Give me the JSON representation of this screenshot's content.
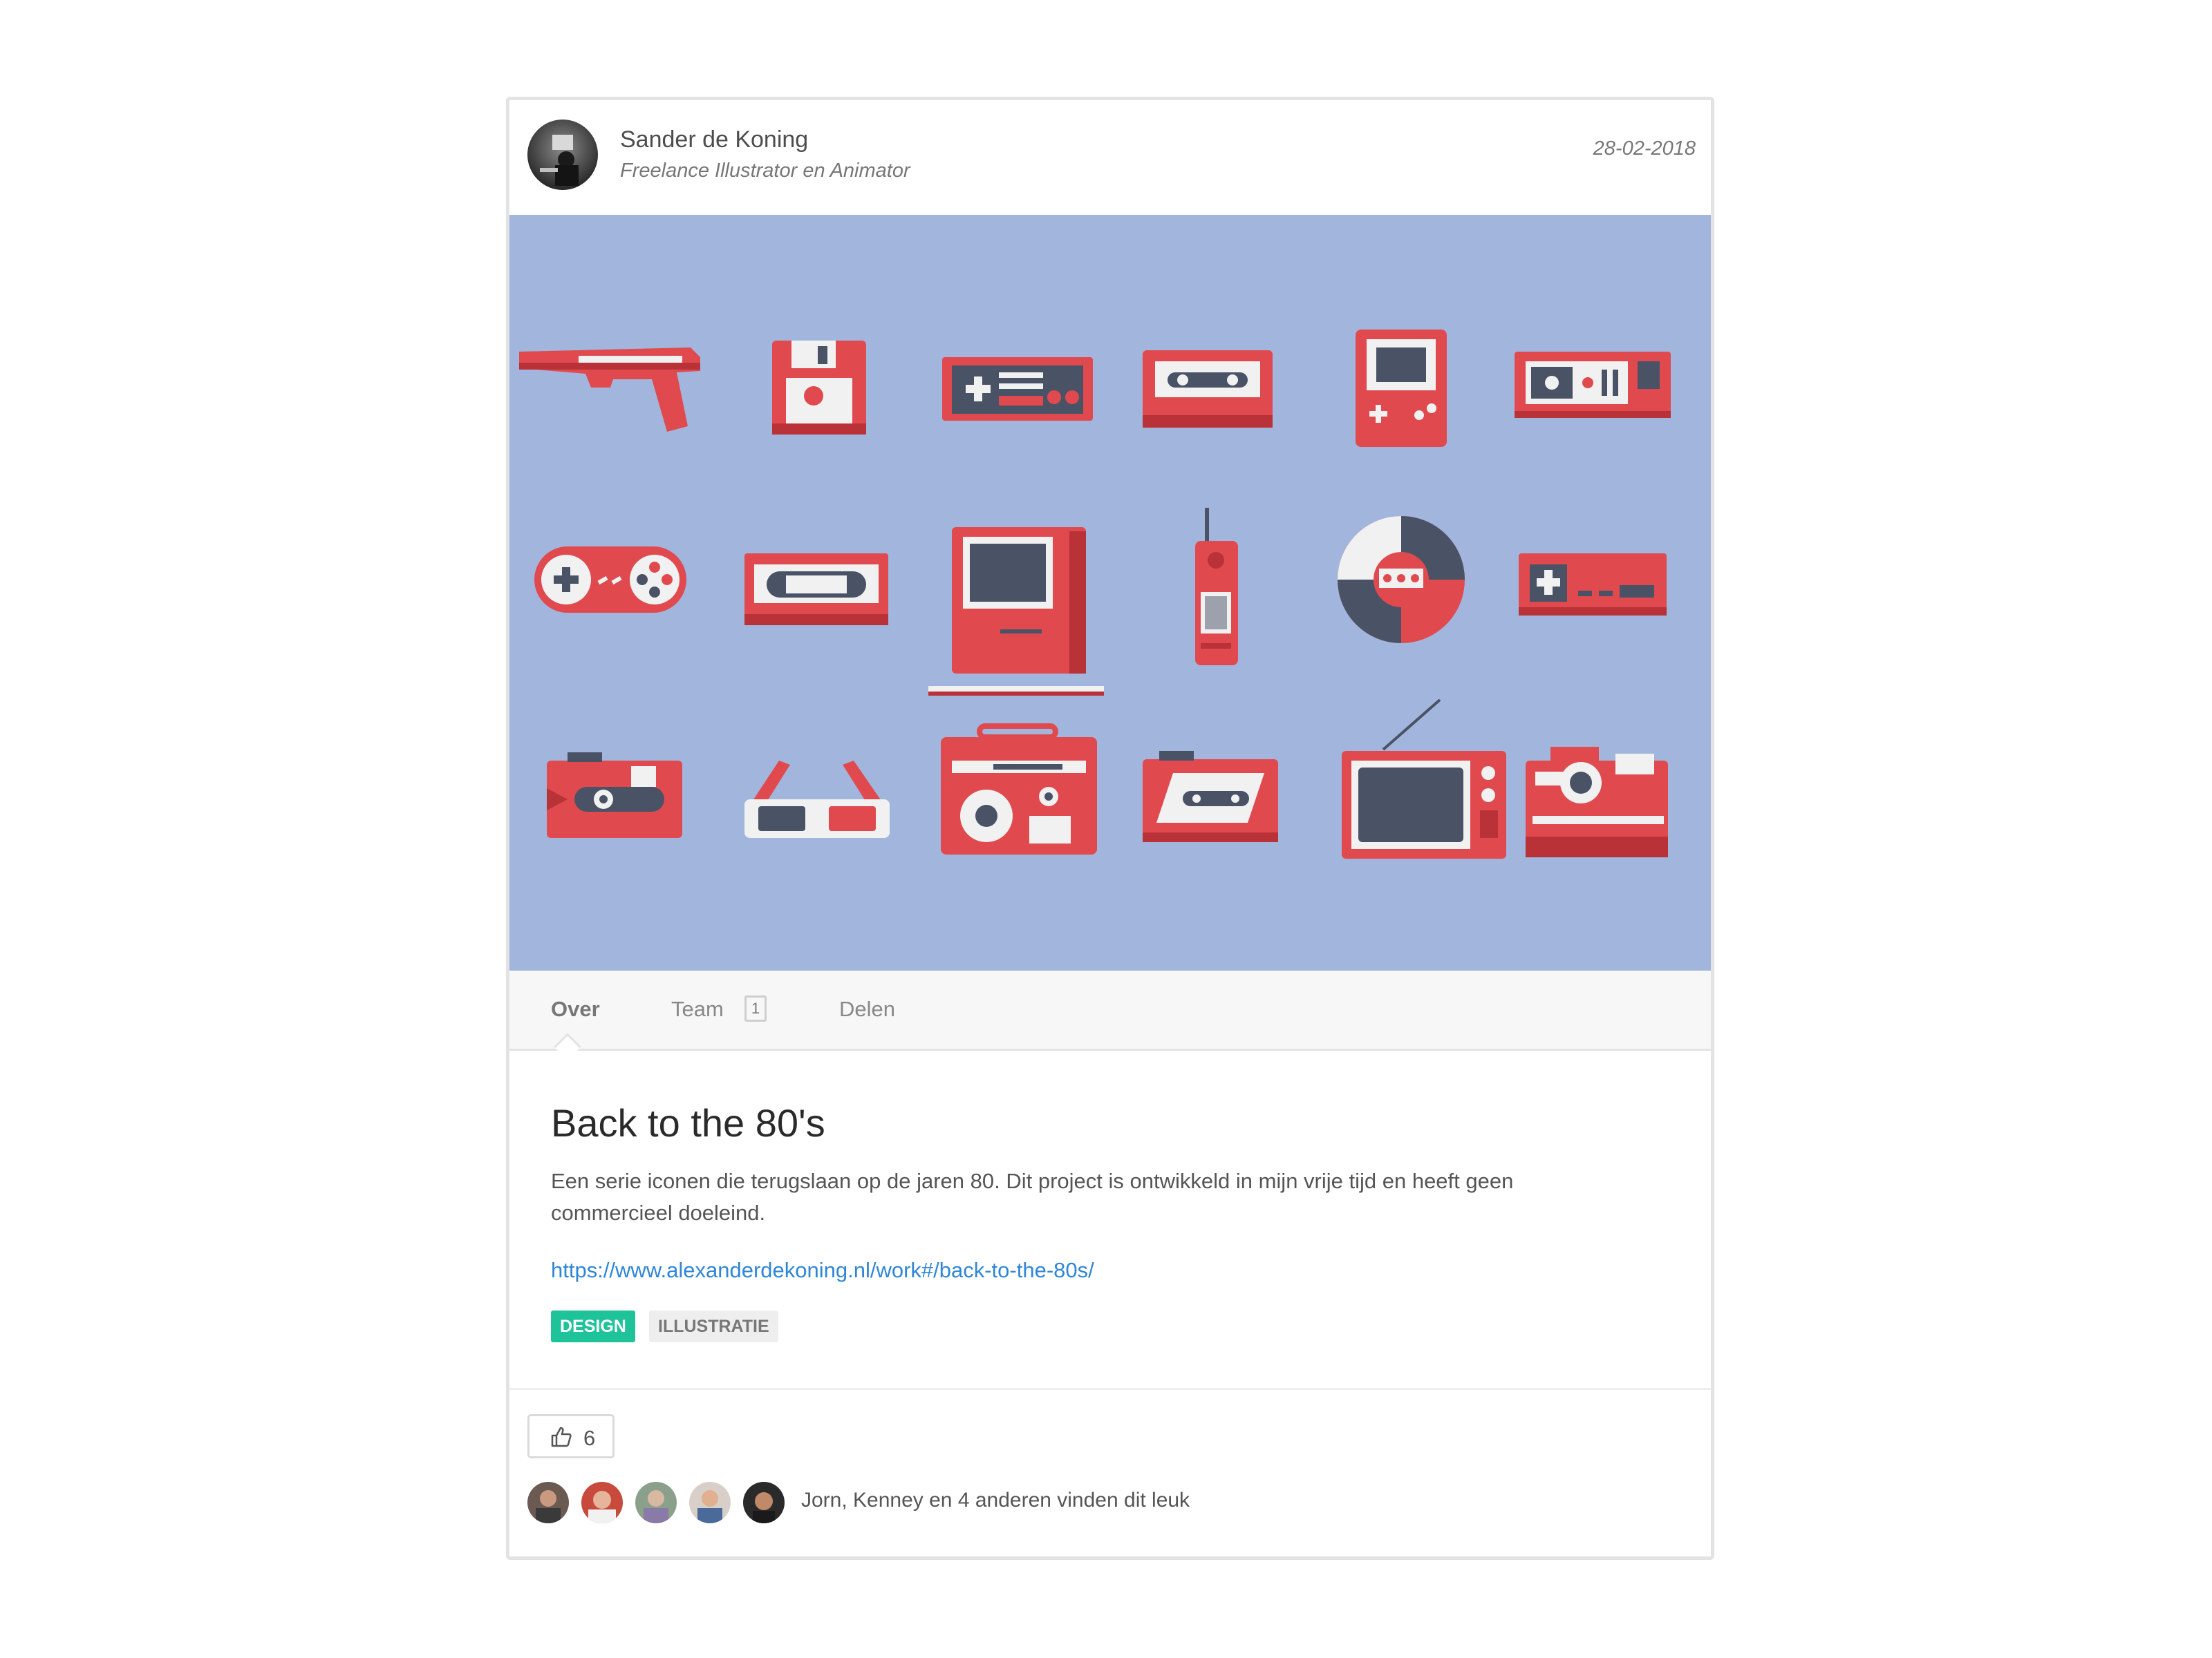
{
  "author": {
    "name": "Sander de Koning",
    "role": "Freelance Illustrator en Animator",
    "date": "28-02-2018"
  },
  "hero": {
    "background": "#a2b6dd",
    "accent": "#e04a4f",
    "dark": "#4a5266",
    "icons": [
      "zapper-gun-icon",
      "floppy-disk-icon",
      "nes-controller-icon",
      "cassette-tape-icon",
      "gameboy-icon",
      "atari-console-icon",
      "snes-controller-icon",
      "vhs-tape-icon",
      "macintosh-icon",
      "brick-phone-icon",
      "trivial-pursuit-icon",
      "nes-console-icon",
      "compact-camera-icon",
      "3d-glasses-icon",
      "boombox-icon",
      "walkman-icon",
      "crt-tv-icon",
      "polaroid-camera-icon"
    ]
  },
  "tabs": {
    "over": "Over",
    "team": "Team",
    "team_count": "1",
    "delen": "Delen"
  },
  "content": {
    "title": "Back to the 80's",
    "description": "Een serie iconen die terugslaan op de jaren 80. Dit project is ontwikkeld in mijn vrije tijd en heeft geen commercieel doeleind.",
    "link": "https://www.alexanderdekoning.nl/work#/back-to-the-80s/",
    "tags": [
      "DESIGN",
      "ILLUSTRATIE"
    ]
  },
  "likes": {
    "count": "6",
    "icon": "thumbs-up-icon",
    "text": "Jorn, Kenney en 4 anderen vinden dit leuk"
  },
  "colors": {
    "design_tag": "#1fc39a",
    "link": "#2f86d6"
  }
}
